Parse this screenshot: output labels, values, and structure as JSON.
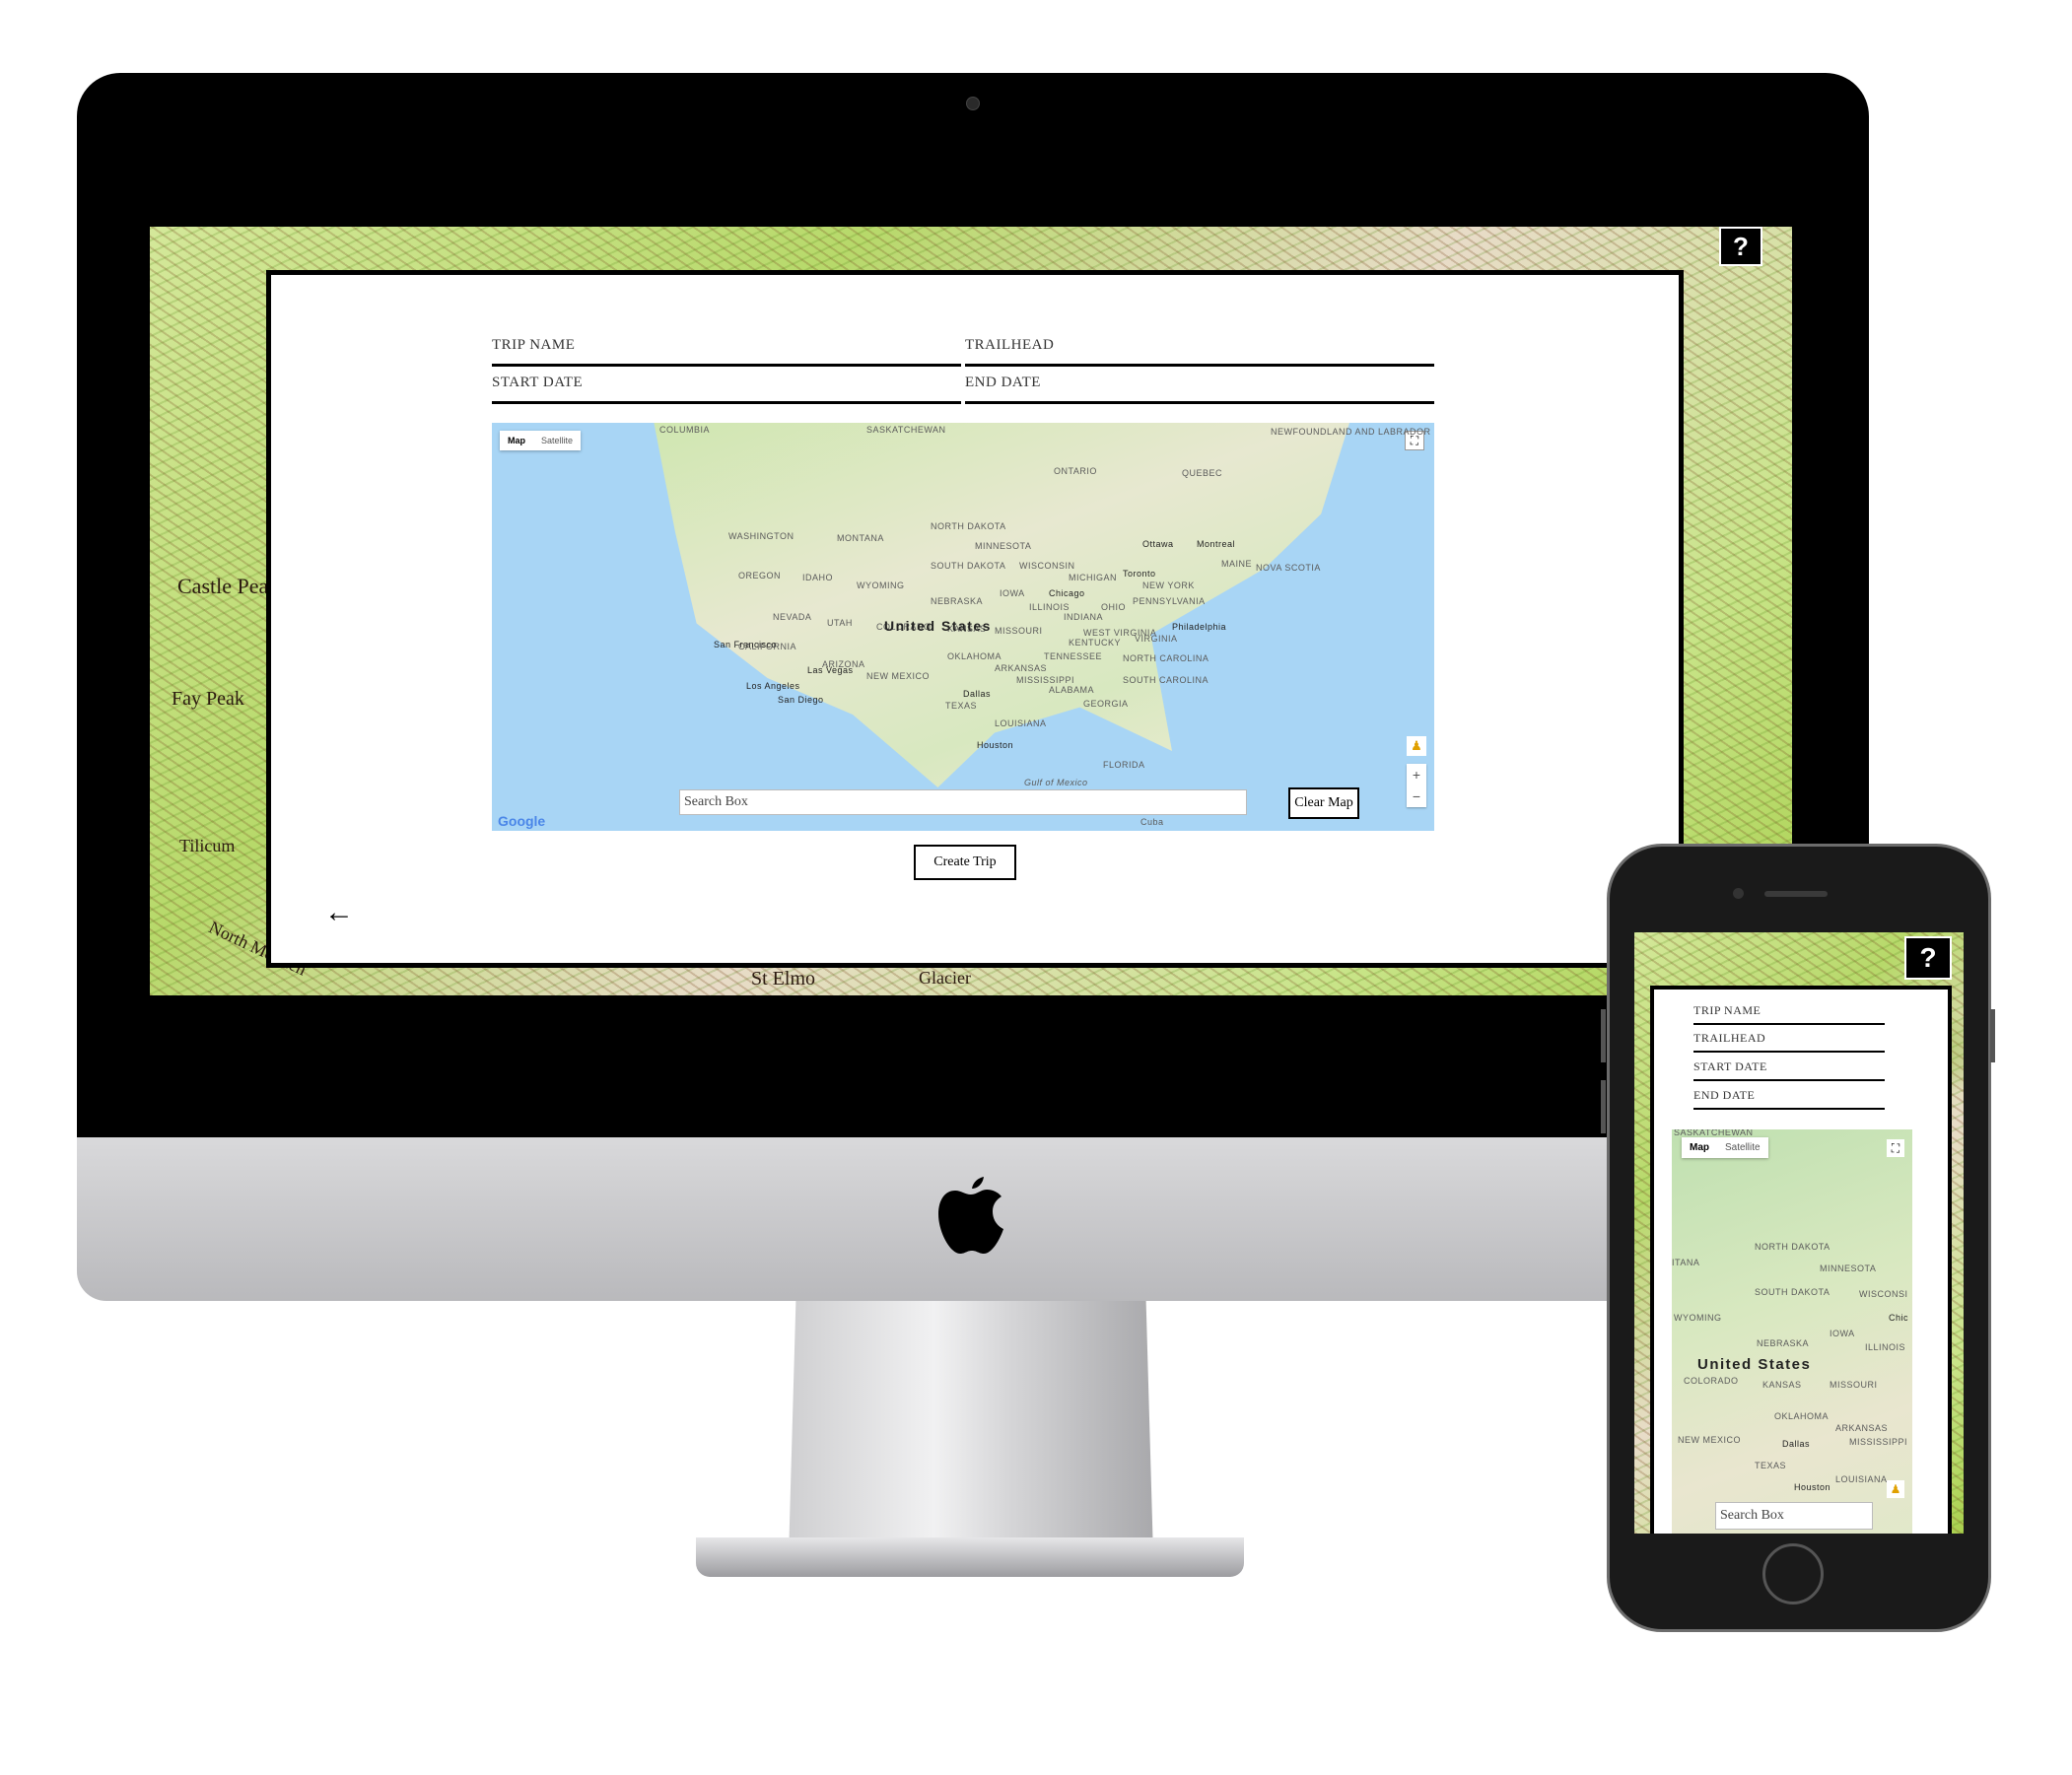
{
  "app": {
    "help_label": "?",
    "back_arrow": "←"
  },
  "form": {
    "trip_name": "Trip Name",
    "trailhead": "Trailhead",
    "start_date": "Start Date",
    "end_date": "End Date",
    "search_placeholder": "Search Box",
    "clear_map": "Clear Map",
    "create_trip": "Create Trip"
  },
  "map": {
    "tab_map": "Map",
    "tab_satellite": "Satellite",
    "google": "Google",
    "zoom_in": "+",
    "zoom_out": "−",
    "country": "United States",
    "labels": [
      "COLUMBIA",
      "SASKATCHEWAN",
      "NEWFOUNDLAND AND LABRADOR",
      "ONTARIO",
      "QUEBEC",
      "WASHINGTON",
      "MONTANA",
      "NORTH DAKOTA",
      "MINNESOTA",
      "OREGON",
      "IDAHO",
      "SOUTH DAKOTA",
      "WISCONSIN",
      "WYOMING",
      "MICHIGAN",
      "NEBRASKA",
      "IOWA",
      "NEVADA",
      "UTAH",
      "ILLINOIS",
      "INDIANA",
      "OHIO",
      "COLORADO",
      "KANSAS",
      "MISSOURI",
      "KENTUCKY",
      "CALIFORNIA",
      "ARIZONA",
      "OKLAHOMA",
      "TENNESSEE",
      "NEW MEXICO",
      "ARKANSAS",
      "MISSISSIPPI",
      "ALABAMA",
      "GEORGIA",
      "TEXAS",
      "LOUISIANA",
      "FLORIDA",
      "NORTH CAROLINA",
      "SOUTH CAROLINA",
      "VIRGINIA",
      "WEST VIRGINIA",
      "NEW YORK",
      "PENNSYLVANIA",
      "MAINE",
      "NOVA SCOTIA",
      "Gulf of Mexico",
      "Cuba"
    ],
    "cities": [
      "Ottawa",
      "Montreal",
      "Toronto",
      "Chicago",
      "Philadelphia",
      "San Francisco",
      "Las Vegas",
      "Los Angeles",
      "San Diego",
      "Dallas",
      "Houston"
    ]
  },
  "topo": {
    "labels": [
      "Castle Peak",
      "Fay Peak",
      "Tilicum",
      "St Elmo",
      "Glacier",
      "North Mowich"
    ]
  },
  "phone": {
    "map_labels": [
      "SASKATCHEWAN",
      "NORTH DAKOTA",
      "MINNESOTA",
      "SOUTH DAKOTA",
      "WISCONSI",
      "WYOMING",
      "IOWA",
      "NEBRASKA",
      "ILLINOIS",
      "COLORADO",
      "KANSAS",
      "MISSOURI",
      "OKLAHOMA",
      "ARKANSAS",
      "NEW MEXICO",
      "MISSISSIPPI",
      "TEXAS",
      "LOUISIANA",
      "ITANA"
    ],
    "cities": [
      "Dallas",
      "Houston",
      "Chic"
    ]
  }
}
